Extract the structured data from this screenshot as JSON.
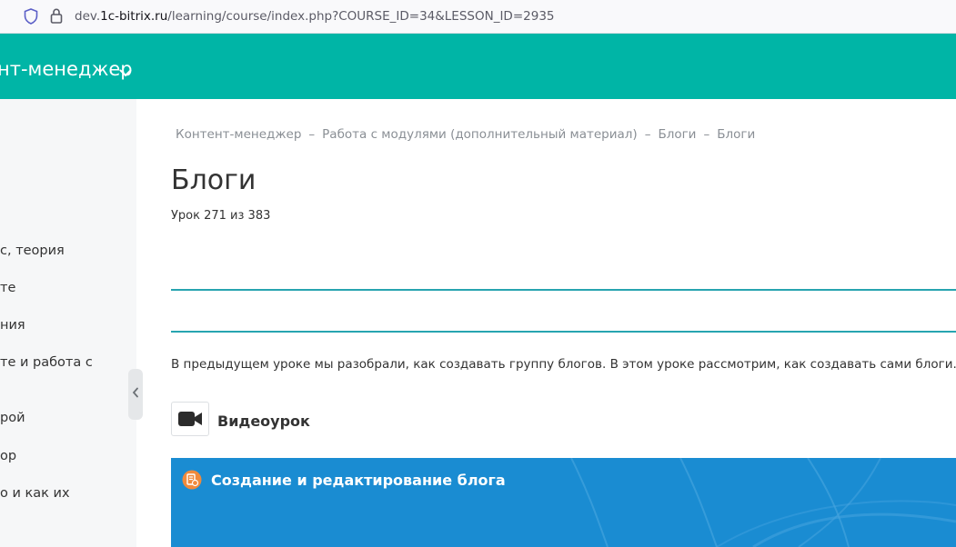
{
  "browser": {
    "url_prefix": "dev.",
    "url_domain": "1c-bitrix.ru",
    "url_path": "/learning/course/index.php?COURSE_ID=34&LESSON_ID=2935"
  },
  "header": {
    "course_title": "нт-менеджер"
  },
  "sidebar": {
    "items": [
      {
        "label": "с, теория"
      },
      {
        "label": "те"
      },
      {
        "label": "ния"
      },
      {
        "label": "те и работа с"
      },
      {
        "label": "рой"
      },
      {
        "label": "ор"
      },
      {
        "label": "о и как их"
      }
    ]
  },
  "breadcrumb": {
    "items": [
      "Контент-менеджер",
      "Работа с модулями (дополнительный материал)",
      "Блоги",
      "Блоги"
    ],
    "separator": "–"
  },
  "lesson": {
    "title": "Блоги",
    "counter": "Урок 271 из 383",
    "intro": "В предыдущем уроке мы разобрали, как создавать группу блогов. В этом уроке рассмотрим, как создавать сами блоги.",
    "video_section_label": "Видеоурок",
    "video_title": "Создание и редактирование блога"
  },
  "colors": {
    "header_bg": "#00b5a6",
    "rule": "#27a4b0",
    "video_bg": "#1a8cd2",
    "video_badge": "#f08a3c"
  }
}
